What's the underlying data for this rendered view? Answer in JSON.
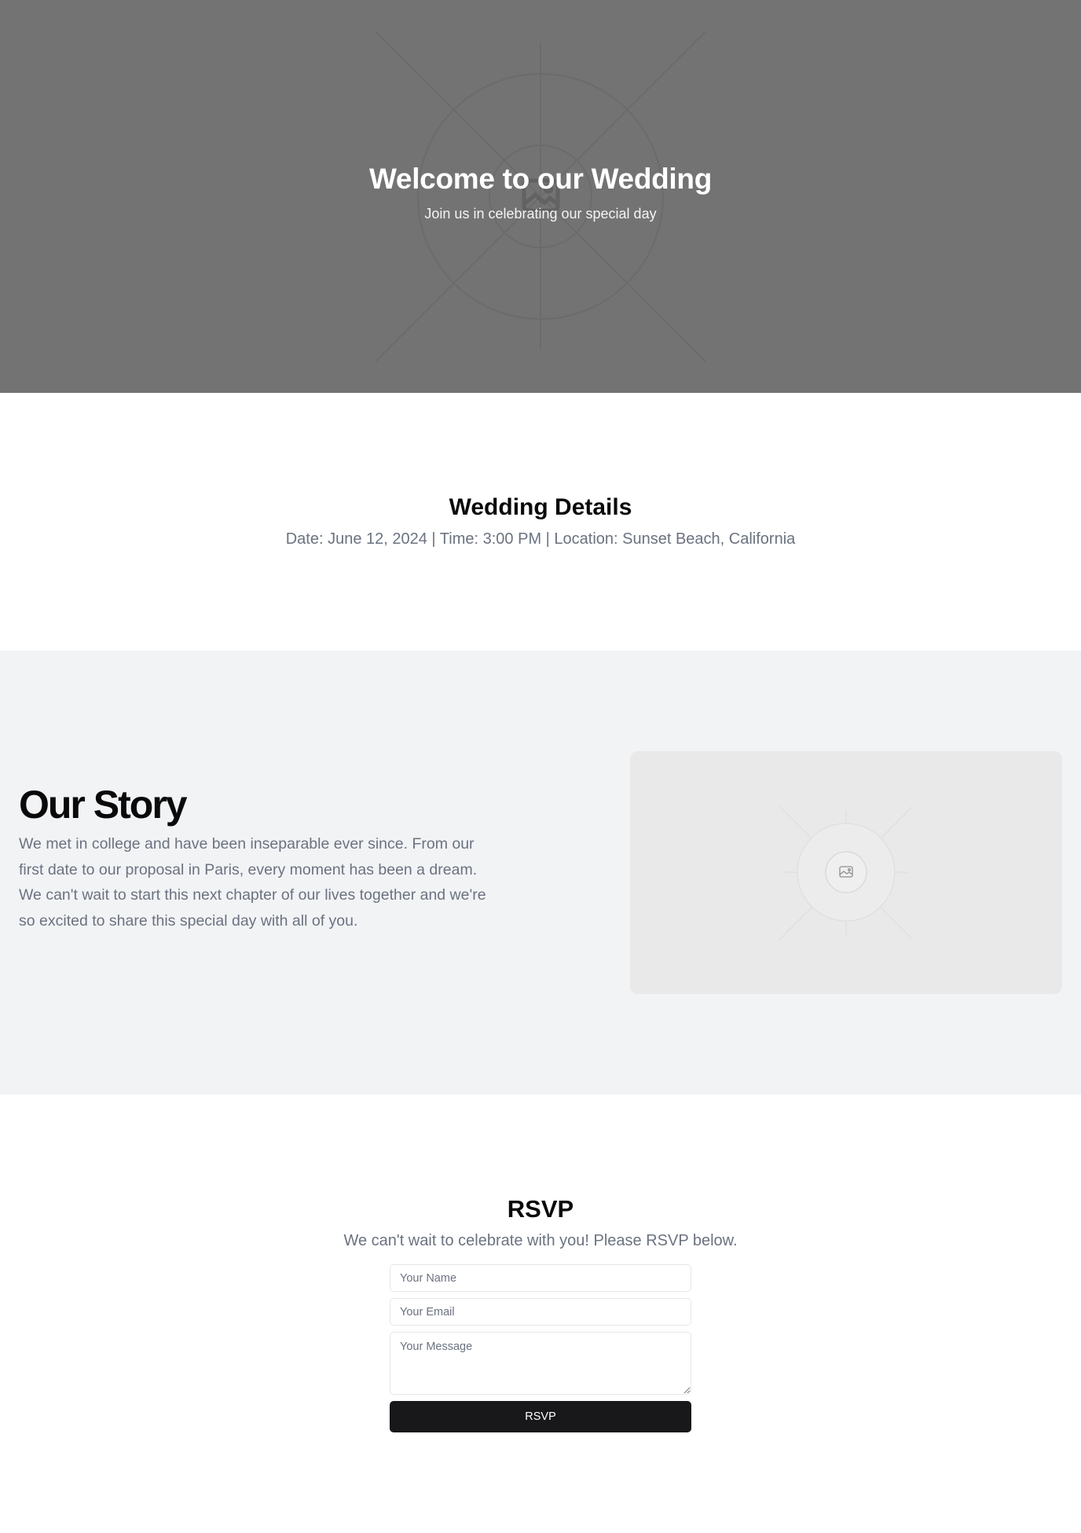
{
  "hero": {
    "title": "Welcome to our Wedding",
    "subtitle": "Join us in celebrating our special day",
    "image_icon": "image-placeholder-icon",
    "background_color": "#737373"
  },
  "details": {
    "title": "Wedding Details",
    "info": "Date: June 12, 2024 | Time: 3:00 PM | Location: Sunset Beach, California"
  },
  "story": {
    "title": "Our Story",
    "body": "We met in college and have been inseparable ever since. From our first date to our proposal in Paris, every moment has been a dream. We can't wait to start this next chapter of our lives together and we're so excited to share this special day with all of you.",
    "image_icon": "image-placeholder-icon",
    "background_color": "#f2f3f5"
  },
  "rsvp": {
    "title": "RSVP",
    "subtitle": "We can't wait to celebrate with you! Please RSVP below.",
    "name_placeholder": "Your Name",
    "email_placeholder": "Your Email",
    "message_placeholder": "Your Message",
    "button_label": "RSVP",
    "button_color": "#18181b"
  }
}
